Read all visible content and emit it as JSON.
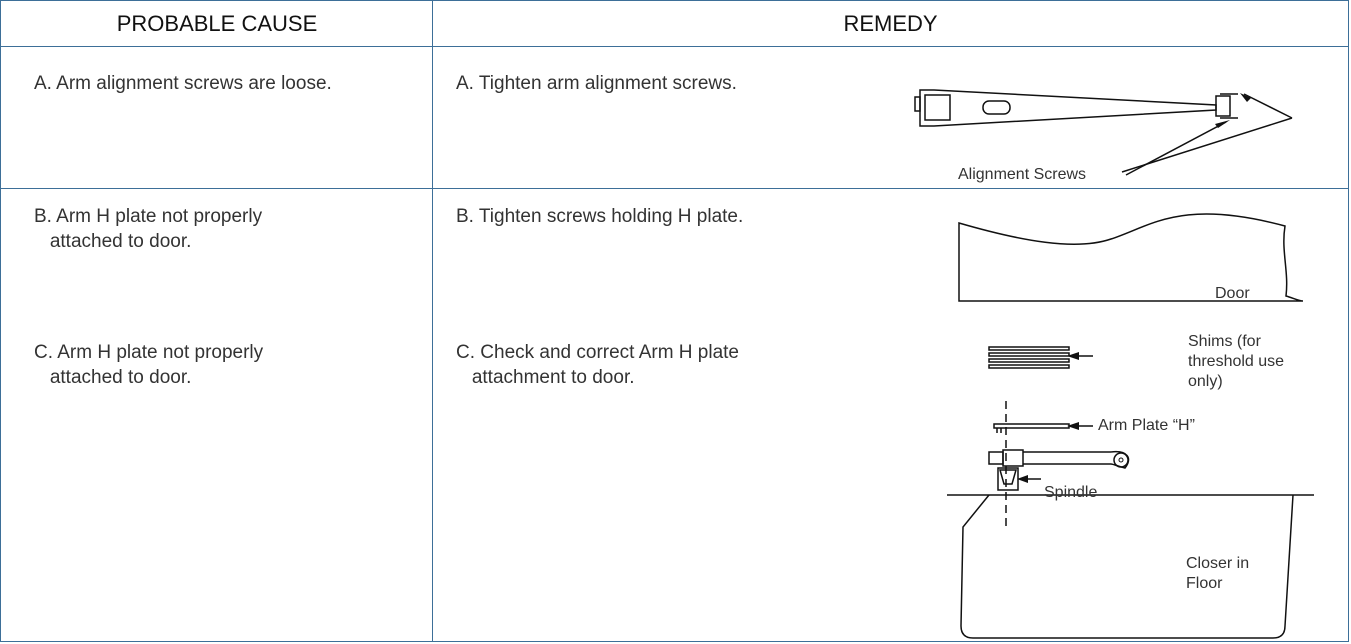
{
  "header": {
    "cause": "PROBABLE CAUSE",
    "remedy": "REMEDY"
  },
  "rows": [
    {
      "cause": "A. Arm alignment screws are loose.",
      "remedy": "A. Tighten arm alignment screws."
    },
    {
      "cause": "B. Arm H plate not properly\n   attached to door.",
      "remedy": "B. Tighten screws holding H plate."
    },
    {
      "cause": "C. Arm H plate not properly\n   attached to door.",
      "remedy": "C. Check and correct Arm H plate\n   attachment to door."
    }
  ],
  "figure_labels": {
    "alignment_screws": "Alignment Screws",
    "door": "Door",
    "shims": "Shims (for\nthreshold use\nonly)",
    "arm_plate": "Arm Plate “H”",
    "spindle": "Spindle",
    "closer": "Closer in\nFloor"
  },
  "colors": {
    "rule": "#3d6f98",
    "text": "#333333",
    "line_art": "#111111"
  }
}
